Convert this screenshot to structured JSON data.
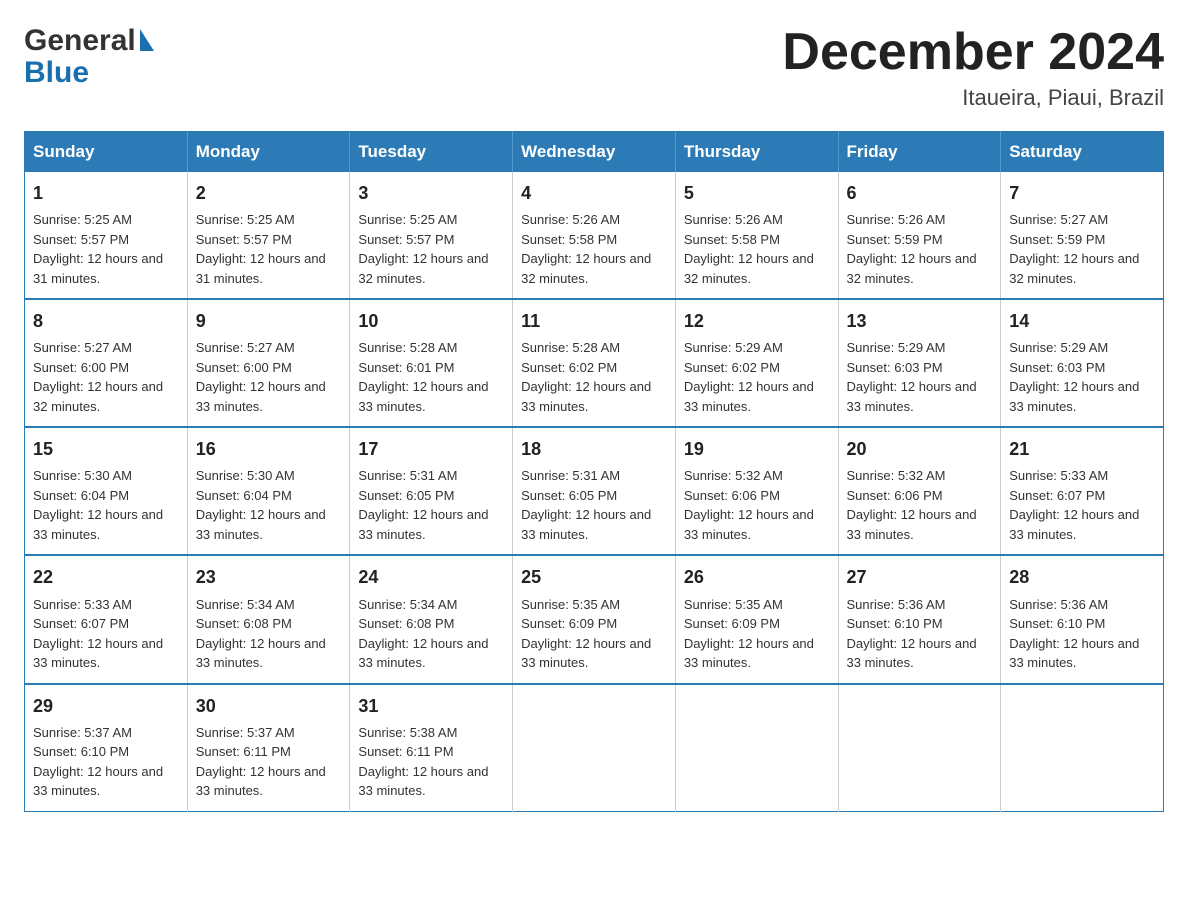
{
  "header": {
    "logo_general": "General",
    "logo_blue": "Blue",
    "month_title": "December 2024",
    "location": "Itaueira, Piaui, Brazil"
  },
  "calendar": {
    "days_of_week": [
      "Sunday",
      "Monday",
      "Tuesday",
      "Wednesday",
      "Thursday",
      "Friday",
      "Saturday"
    ],
    "weeks": [
      [
        {
          "day": "1",
          "sunrise": "Sunrise: 5:25 AM",
          "sunset": "Sunset: 5:57 PM",
          "daylight": "Daylight: 12 hours and 31 minutes."
        },
        {
          "day": "2",
          "sunrise": "Sunrise: 5:25 AM",
          "sunset": "Sunset: 5:57 PM",
          "daylight": "Daylight: 12 hours and 31 minutes."
        },
        {
          "day": "3",
          "sunrise": "Sunrise: 5:25 AM",
          "sunset": "Sunset: 5:57 PM",
          "daylight": "Daylight: 12 hours and 32 minutes."
        },
        {
          "day": "4",
          "sunrise": "Sunrise: 5:26 AM",
          "sunset": "Sunset: 5:58 PM",
          "daylight": "Daylight: 12 hours and 32 minutes."
        },
        {
          "day": "5",
          "sunrise": "Sunrise: 5:26 AM",
          "sunset": "Sunset: 5:58 PM",
          "daylight": "Daylight: 12 hours and 32 minutes."
        },
        {
          "day": "6",
          "sunrise": "Sunrise: 5:26 AM",
          "sunset": "Sunset: 5:59 PM",
          "daylight": "Daylight: 12 hours and 32 minutes."
        },
        {
          "day": "7",
          "sunrise": "Sunrise: 5:27 AM",
          "sunset": "Sunset: 5:59 PM",
          "daylight": "Daylight: 12 hours and 32 minutes."
        }
      ],
      [
        {
          "day": "8",
          "sunrise": "Sunrise: 5:27 AM",
          "sunset": "Sunset: 6:00 PM",
          "daylight": "Daylight: 12 hours and 32 minutes."
        },
        {
          "day": "9",
          "sunrise": "Sunrise: 5:27 AM",
          "sunset": "Sunset: 6:00 PM",
          "daylight": "Daylight: 12 hours and 33 minutes."
        },
        {
          "day": "10",
          "sunrise": "Sunrise: 5:28 AM",
          "sunset": "Sunset: 6:01 PM",
          "daylight": "Daylight: 12 hours and 33 minutes."
        },
        {
          "day": "11",
          "sunrise": "Sunrise: 5:28 AM",
          "sunset": "Sunset: 6:02 PM",
          "daylight": "Daylight: 12 hours and 33 minutes."
        },
        {
          "day": "12",
          "sunrise": "Sunrise: 5:29 AM",
          "sunset": "Sunset: 6:02 PM",
          "daylight": "Daylight: 12 hours and 33 minutes."
        },
        {
          "day": "13",
          "sunrise": "Sunrise: 5:29 AM",
          "sunset": "Sunset: 6:03 PM",
          "daylight": "Daylight: 12 hours and 33 minutes."
        },
        {
          "day": "14",
          "sunrise": "Sunrise: 5:29 AM",
          "sunset": "Sunset: 6:03 PM",
          "daylight": "Daylight: 12 hours and 33 minutes."
        }
      ],
      [
        {
          "day": "15",
          "sunrise": "Sunrise: 5:30 AM",
          "sunset": "Sunset: 6:04 PM",
          "daylight": "Daylight: 12 hours and 33 minutes."
        },
        {
          "day": "16",
          "sunrise": "Sunrise: 5:30 AM",
          "sunset": "Sunset: 6:04 PM",
          "daylight": "Daylight: 12 hours and 33 minutes."
        },
        {
          "day": "17",
          "sunrise": "Sunrise: 5:31 AM",
          "sunset": "Sunset: 6:05 PM",
          "daylight": "Daylight: 12 hours and 33 minutes."
        },
        {
          "day": "18",
          "sunrise": "Sunrise: 5:31 AM",
          "sunset": "Sunset: 6:05 PM",
          "daylight": "Daylight: 12 hours and 33 minutes."
        },
        {
          "day": "19",
          "sunrise": "Sunrise: 5:32 AM",
          "sunset": "Sunset: 6:06 PM",
          "daylight": "Daylight: 12 hours and 33 minutes."
        },
        {
          "day": "20",
          "sunrise": "Sunrise: 5:32 AM",
          "sunset": "Sunset: 6:06 PM",
          "daylight": "Daylight: 12 hours and 33 minutes."
        },
        {
          "day": "21",
          "sunrise": "Sunrise: 5:33 AM",
          "sunset": "Sunset: 6:07 PM",
          "daylight": "Daylight: 12 hours and 33 minutes."
        }
      ],
      [
        {
          "day": "22",
          "sunrise": "Sunrise: 5:33 AM",
          "sunset": "Sunset: 6:07 PM",
          "daylight": "Daylight: 12 hours and 33 minutes."
        },
        {
          "day": "23",
          "sunrise": "Sunrise: 5:34 AM",
          "sunset": "Sunset: 6:08 PM",
          "daylight": "Daylight: 12 hours and 33 minutes."
        },
        {
          "day": "24",
          "sunrise": "Sunrise: 5:34 AM",
          "sunset": "Sunset: 6:08 PM",
          "daylight": "Daylight: 12 hours and 33 minutes."
        },
        {
          "day": "25",
          "sunrise": "Sunrise: 5:35 AM",
          "sunset": "Sunset: 6:09 PM",
          "daylight": "Daylight: 12 hours and 33 minutes."
        },
        {
          "day": "26",
          "sunrise": "Sunrise: 5:35 AM",
          "sunset": "Sunset: 6:09 PM",
          "daylight": "Daylight: 12 hours and 33 minutes."
        },
        {
          "day": "27",
          "sunrise": "Sunrise: 5:36 AM",
          "sunset": "Sunset: 6:10 PM",
          "daylight": "Daylight: 12 hours and 33 minutes."
        },
        {
          "day": "28",
          "sunrise": "Sunrise: 5:36 AM",
          "sunset": "Sunset: 6:10 PM",
          "daylight": "Daylight: 12 hours and 33 minutes."
        }
      ],
      [
        {
          "day": "29",
          "sunrise": "Sunrise: 5:37 AM",
          "sunset": "Sunset: 6:10 PM",
          "daylight": "Daylight: 12 hours and 33 minutes."
        },
        {
          "day": "30",
          "sunrise": "Sunrise: 5:37 AM",
          "sunset": "Sunset: 6:11 PM",
          "daylight": "Daylight: 12 hours and 33 minutes."
        },
        {
          "day": "31",
          "sunrise": "Sunrise: 5:38 AM",
          "sunset": "Sunset: 6:11 PM",
          "daylight": "Daylight: 12 hours and 33 minutes."
        },
        null,
        null,
        null,
        null
      ]
    ]
  }
}
